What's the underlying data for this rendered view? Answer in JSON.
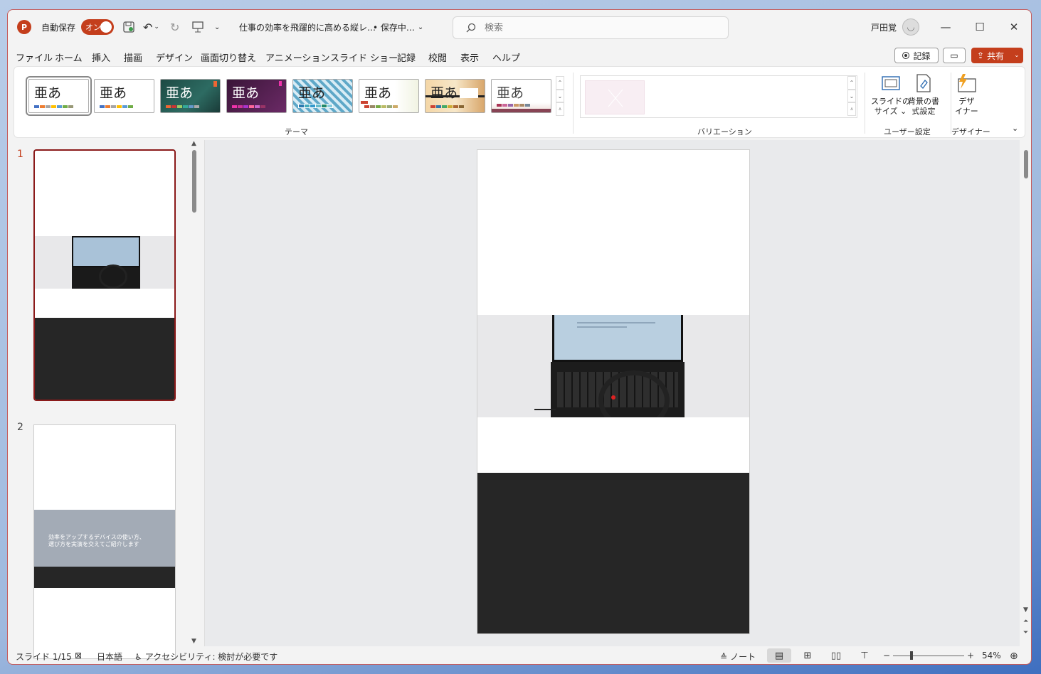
{
  "titlebar": {
    "app_logo": "P",
    "autosave_label": "自動保存",
    "autosave_state": "オン",
    "doc_title": "仕事の効率を飛躍的に高める縦レ…",
    "save_status": "• 保存中…",
    "search_placeholder": "検索",
    "user_name": "戸田覚"
  },
  "menu": {
    "items": [
      "ファイル",
      "ホーム",
      "挿入",
      "描画",
      "デザイン",
      "画面切り替え",
      "アニメーション",
      "スライド ショー",
      "記録",
      "校閲",
      "表示",
      "ヘルプ"
    ],
    "active": "デザイン",
    "record_button": "記録",
    "share_button": "共有"
  },
  "ribbon": {
    "theme_sample_text": "亜あ",
    "themes_group_label": "テーマ",
    "variations_group_label": "バリエーション",
    "user_settings_label": "ユーザー設定",
    "designer_group_label": "デザイナー",
    "slide_size_line1": "スライドの",
    "slide_size_line2": "サイズ ⌄",
    "bg_format_line1": "背景の書",
    "bg_format_line2": "式設定",
    "designer_line1": "デザ",
    "designer_line2": "イナー"
  },
  "slides": {
    "thumb1_num": "1",
    "thumb2_num": "2",
    "thumb2_text_line1": "効率をアップするデバイスの使い方、",
    "thumb2_text_line2": "選び方を実演を交えてご紹介します"
  },
  "statusbar": {
    "slide_info": "スライド 1/15",
    "language": "日本語",
    "accessibility": "アクセシビリティ: 検討が必要です",
    "notes": "ノート",
    "zoom_minus": "−",
    "zoom_plus": "+",
    "zoom_level": "54%"
  },
  "colors": {
    "accent": "#c43e1c",
    "selected_thumb_border": "#8b1a1a",
    "slide_dark_band": "#262626",
    "thumb2_band": "#a3abb6"
  }
}
